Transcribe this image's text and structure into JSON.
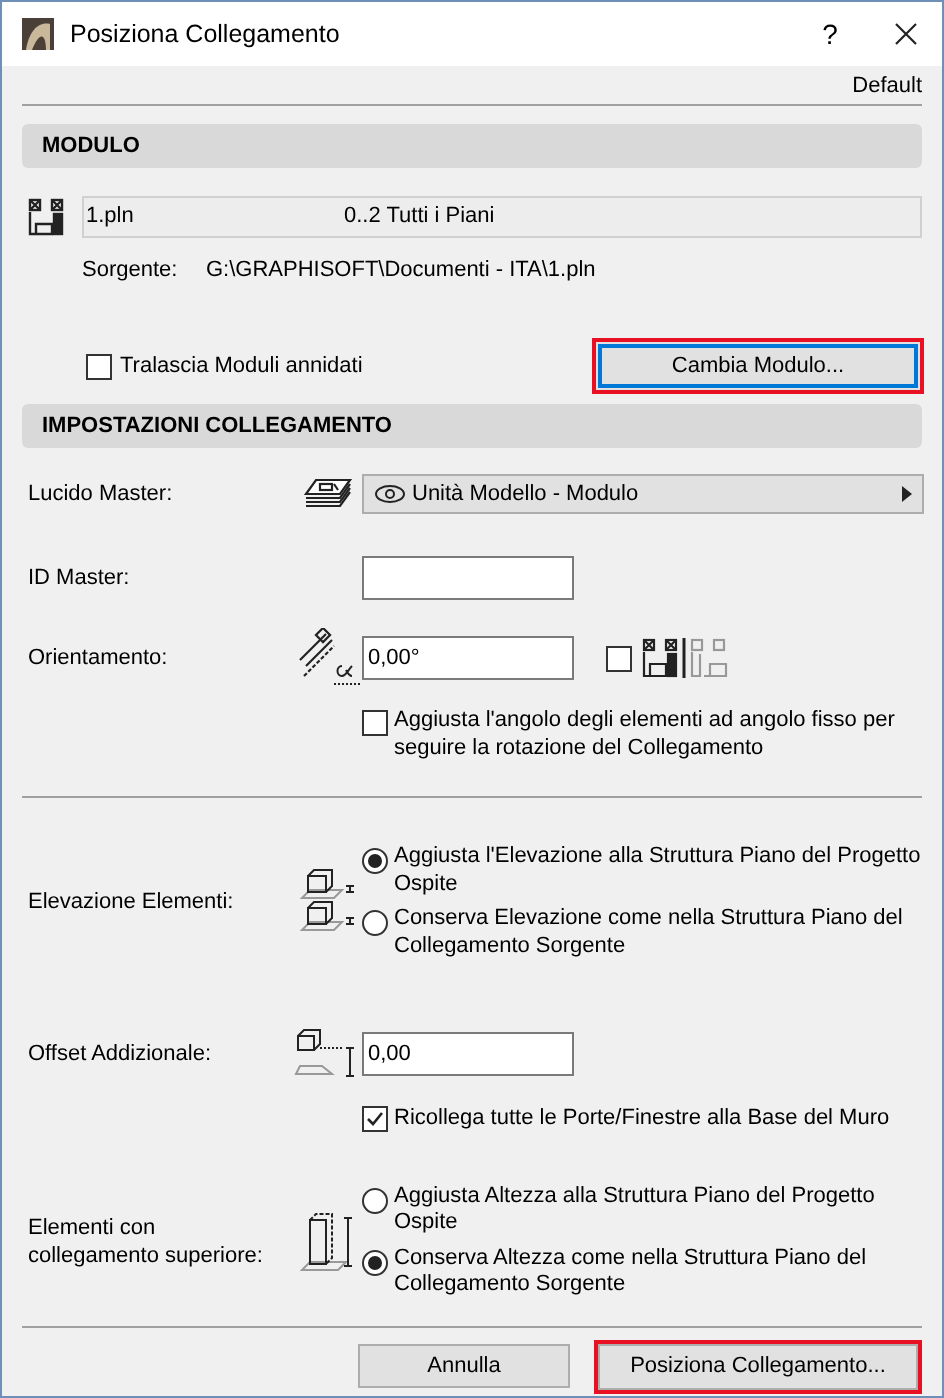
{
  "window": {
    "title": "Posiziona Collegamento",
    "help": "?"
  },
  "preset": "Default",
  "module_section": {
    "heading": "MODULO",
    "module": {
      "name": "1.pln",
      "stories": "0..2 Tutti i Piani"
    },
    "source_label": "Sorgente:",
    "source_path": "G:\\GRAPHISOFT\\Documenti - ITA\\1.pln",
    "skip_nested": {
      "label": "Tralascia Moduli annidati",
      "checked": false
    },
    "change_button": {
      "label": "Cambia Modulo...",
      "focused": true,
      "highlighted": true
    }
  },
  "settings_section": {
    "heading": "IMPOSTAZIONI COLLEGAMENTO",
    "master_layer": {
      "label": "Lucido Master:",
      "value": "Unità Modello - Modulo"
    },
    "master_id": {
      "label": "ID Master:"
    },
    "orientation": {
      "label": "Orientamento:",
      "value": "0,00°",
      "mirror_checked": false
    },
    "adjust_angle": {
      "label": "Aggiusta l'angolo degli elementi ad angolo fisso per seguire la rotazione del Collegamento",
      "checked": false
    },
    "element_elevation": {
      "label": "Elevazione Elementi:",
      "options": [
        {
          "label": "Aggiusta l'Elevazione alla Struttura Piano del Progetto Ospite",
          "selected": true
        },
        {
          "label": "Conserva Elevazione come nella Struttura Piano del Collegamento Sorgente",
          "selected": false
        }
      ]
    },
    "additional_offset": {
      "label": "Offset Addizionale:",
      "value": "0,00"
    },
    "relink": {
      "label": "Ricollega tutte le Porte/Finestre alla Base del Muro",
      "checked": true
    },
    "top_linked": {
      "label": "Elementi con collegamento superiore:",
      "options": [
        {
          "label": "Aggiusta Altezza alla Struttura Piano del Progetto Ospite",
          "selected": false
        },
        {
          "label": "Conserva Altezza come nella Struttura Piano del Collegamento Sorgente",
          "selected": true
        }
      ]
    }
  },
  "buttons": [
    {
      "label": "Annulla",
      "highlighted": false
    },
    {
      "label": "Posiziona Collegamento...",
      "highlighted": true
    }
  ]
}
